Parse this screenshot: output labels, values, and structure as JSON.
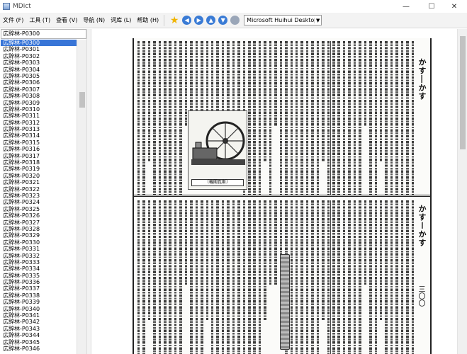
{
  "window": {
    "title": "MDict",
    "minimize": "—",
    "maximize": "☐",
    "close": "✕"
  },
  "menu": [
    {
      "label": "文件 (F)"
    },
    {
      "label": "工具 (T)"
    },
    {
      "label": "查看 (V)"
    },
    {
      "label": "导航 (N)"
    },
    {
      "label": "词库 (L)"
    },
    {
      "label": "帮助 (H)"
    }
  ],
  "toolbar": {
    "star_icon": "★",
    "back_icon": "◀",
    "forward_icon": "▶",
    "prev_icon": "▲",
    "next_icon": "▼",
    "dictionary_selector": "Microsoft Huihui Desktop - C",
    "dropdown_arrow": "▼"
  },
  "search": {
    "value": "広辞林-P0300"
  },
  "entries": [
    "広辞林-P0300",
    "広辞林-P0301",
    "広辞林-P0302",
    "広辞林-P0303",
    "広辞林-P0304",
    "広辞林-P0305",
    "広辞林-P0306",
    "広辞林-P0307",
    "広辞林-P0308",
    "広辞林-P0309",
    "広辞林-P0310",
    "広辞林-P0311",
    "広辞林-P0312",
    "広辞林-P0313",
    "広辞林-P0314",
    "広辞林-P0315",
    "広辞林-P0316",
    "広辞林-P0317",
    "広辞林-P0318",
    "広辞林-P0319",
    "広辞林-P0320",
    "広辞林-P0321",
    "広辞林-P0322",
    "広辞林-P0323",
    "広辞林-P0324",
    "広辞林-P0325",
    "広辞林-P0326",
    "広辞林-P0327",
    "広辞林-P0328",
    "広辞林-P0329",
    "広辞林-P0330",
    "広辞林-P0331",
    "広辞林-P0332",
    "広辞林-P0333",
    "広辞林-P0334",
    "広辞林-P0335",
    "広辞林-P0336",
    "広辞林-P0337",
    "広辞林-P0338",
    "広辞林-P0339",
    "広辞林-P0340",
    "広辞林-P0341",
    "広辞林-P0342",
    "広辞林-P0343",
    "広辞林-P0344",
    "広辞林-P0345",
    "広辞林-P0346"
  ],
  "selected_entry": "広辞林-P0300",
  "page": {
    "running_head_top": "かす―かす",
    "running_head_bottom": "かすーかす",
    "page_number": "三〇〇",
    "figure_caption": "〔機關瓦斯〕"
  }
}
